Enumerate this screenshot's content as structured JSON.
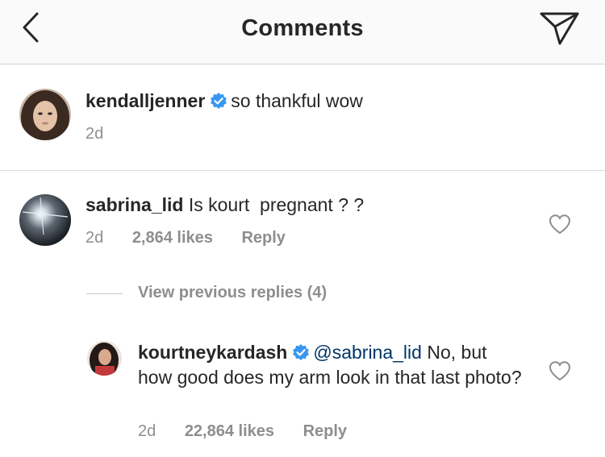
{
  "header": {
    "title": "Comments",
    "back_icon": "chevron-left-icon",
    "send_icon": "direct-send-icon",
    "background": "#fafafa"
  },
  "caption": {
    "username": "kendalljenner",
    "verified": true,
    "text": "so thankful wow",
    "time": "2d"
  },
  "comments": [
    {
      "username": "sabrina_lid",
      "text": "Is kourt  pregnant ? ?",
      "time": "2d",
      "likes": "2,864 likes",
      "reply_label": "Reply"
    }
  ],
  "view_previous_replies": "View previous replies (4)",
  "replies": [
    {
      "username": "kourtneykardash",
      "verified": true,
      "mention": "@sabrina_lid",
      "text": " No, but how good does my arm look in that last photo?",
      "time": "2d",
      "likes": "22,864 likes",
      "reply_label": "Reply"
    }
  ],
  "colors": {
    "verified_blue": "#3897f0",
    "mention": "#003569",
    "meta_gray": "#8e8e8e"
  }
}
